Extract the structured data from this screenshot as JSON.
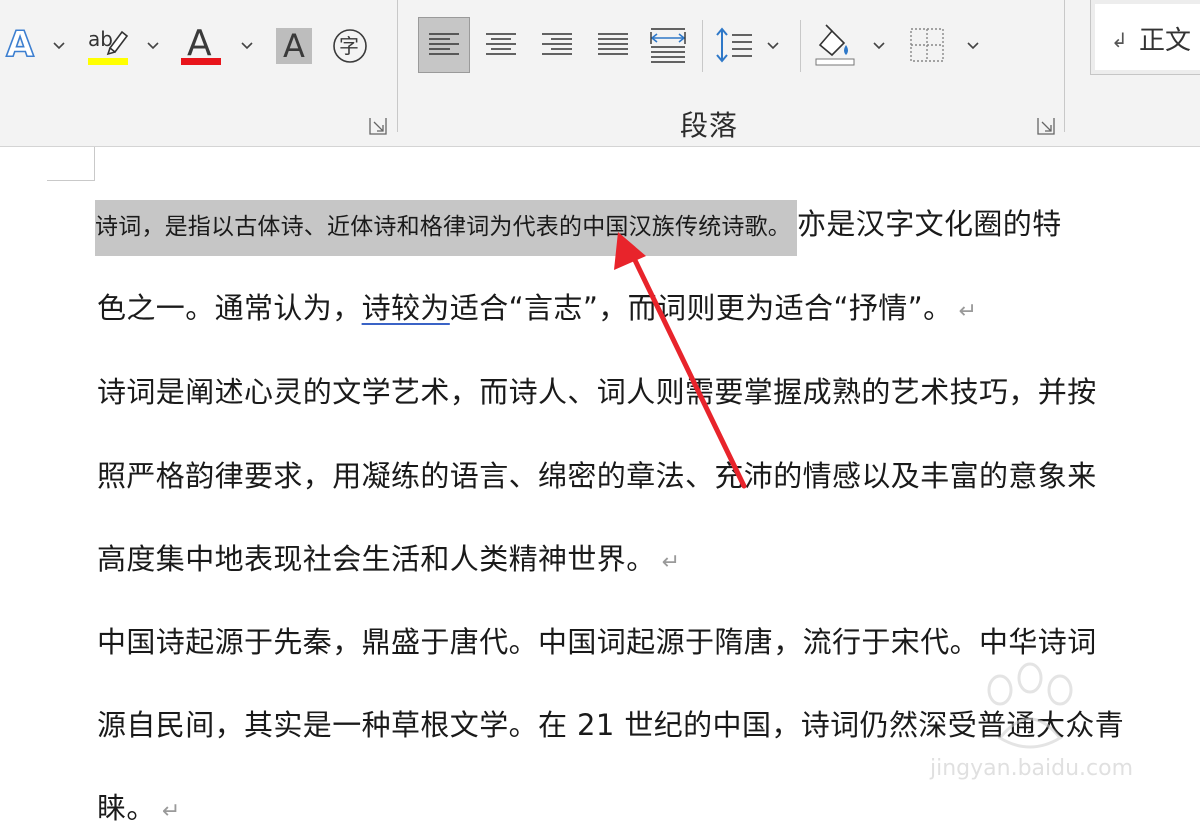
{
  "ribbon": {
    "paragraph_group_label": "段落",
    "char_border_glyph": "字",
    "font_color_glyph": "A",
    "shading_glyph": "A",
    "text_effect_glyph": "A",
    "highlight_glyph": "ab",
    "style_return_mark": "↲",
    "style_name": "正文",
    "colors": {
      "highlight": "#ffff00",
      "font_color": "#e8141b",
      "text_effect": "#4a8fd6",
      "active_button": "#c6c6c6"
    },
    "icons": [
      "text-effect-icon",
      "highlighter-icon",
      "font-color-icon",
      "char-shading-icon",
      "enclosed-char-icon",
      "align-left-icon",
      "align-center-icon",
      "align-right-icon",
      "justify-icon",
      "distributed-icon",
      "line-spacing-icon",
      "shading-icon",
      "borders-icon"
    ]
  },
  "document": {
    "paragraphs": [
      {
        "selected": "诗词，是指以古体诗、近体诗和格律词为代表的中国汉族传统诗歌。",
        "line1_rest": "亦是汉字文化圈的特",
        "line2_a": "色之一。通常认为，",
        "line2_underlined": "诗较为",
        "line2_b": "适合“言志”，而词则更为适合“抒情”。",
        "mark": "↵"
      },
      {
        "line1": "诗词是阐述心灵的文学艺术，而诗人、词人则需要掌握成熟的艺术技巧，并按",
        "line2": "照严格韵律要求，用凝练的语言、绵密的章法、充沛的情感以及丰富的意象来",
        "line3": "高度集中地表现社会生活和人类精神世界。",
        "mark": "↵"
      },
      {
        "line1": "中国诗起源于先秦，鼎盛于唐代。中国词起源于隋唐，流行于宋代。中华诗词",
        "line2": "源自民间，其实是一种草根文学。在 21 世纪的中国，诗词仍然深受普通大众青",
        "line3": "睐。",
        "mark": "↵"
      }
    ]
  },
  "annotation": {
    "arrow_color": "#e8242b"
  },
  "watermark": {
    "text": "jingyan.baidu.com"
  }
}
